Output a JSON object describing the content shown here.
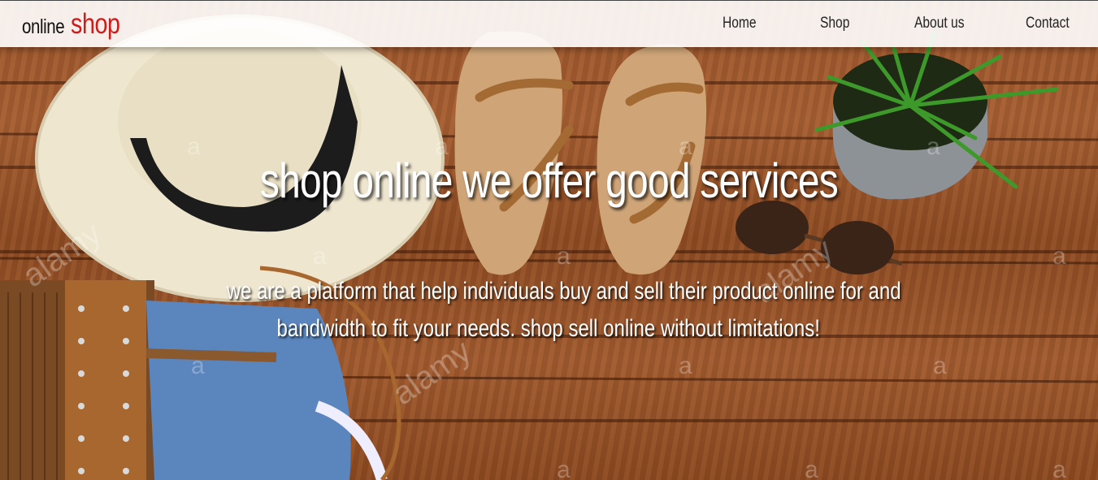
{
  "brand": {
    "prefix": "online",
    "name": "shop",
    "accent_color": "#d21a1a"
  },
  "nav": {
    "items": [
      {
        "label": "Home"
      },
      {
        "label": "Shop"
      },
      {
        "label": "About us"
      },
      {
        "label": "Contact"
      }
    ]
  },
  "hero": {
    "headline": "shop online we offer good services",
    "subtext_line1": "we are a platform that help individuals buy and sell their product online for and",
    "subtext_line2": "bandwidth to fit your needs. shop sell online without limitations!",
    "watermark_text": "alamy",
    "watermark_letter": "a"
  }
}
